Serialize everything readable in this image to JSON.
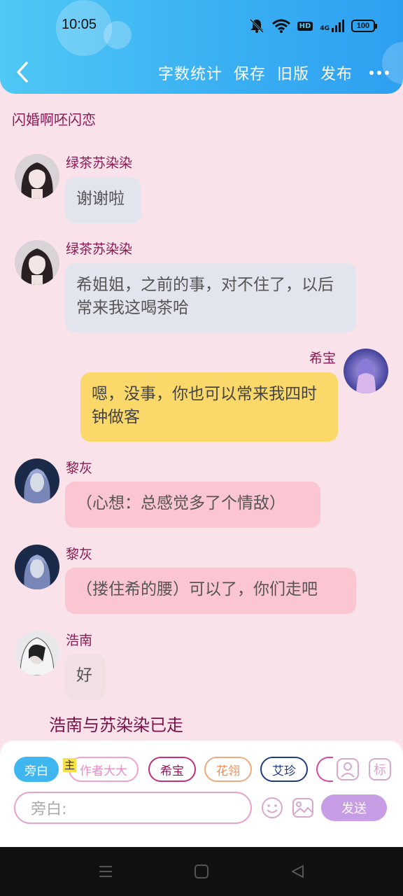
{
  "status_bar": {
    "time": "10:05",
    "hd_label": "HD",
    "network_label": "4G",
    "battery": "100"
  },
  "header": {
    "actions": [
      "字数统计",
      "保存",
      "旧版",
      "发布"
    ]
  },
  "page_title": "闪婚啊呸闪恋",
  "messages": [
    {
      "sender": "绿茶苏染染",
      "text": "谢谢啦",
      "side": "left",
      "style": "gray"
    },
    {
      "sender": "绿茶苏染染",
      "text": "希姐姐，之前的事，对不住了，以后常来我这喝茶哈",
      "side": "left",
      "style": "gray"
    },
    {
      "sender": "希宝",
      "text": "嗯，没事，你也可以常来我四时钟做客",
      "side": "right",
      "style": "yellow"
    },
    {
      "sender": "黎灰",
      "text": "（心想：总感觉多了个情敌）",
      "side": "left",
      "style": "pink"
    },
    {
      "sender": "黎灰",
      "text": "（搂住希的腰）可以了，你们走吧",
      "side": "left",
      "style": "pink"
    },
    {
      "sender": "浩南",
      "text": "好",
      "side": "left",
      "style": "gray"
    }
  ],
  "narration": "浩南与苏染染已走",
  "role_chips": [
    "旁白",
    "作者大大",
    "希宝",
    "花翎",
    "艾珍"
  ],
  "host_tag": "主",
  "side_icons": [
    "人",
    "标"
  ],
  "input": {
    "placeholder": "旁白:",
    "send_label": "发送"
  },
  "colors": {
    "header": "#3ab0f3",
    "background": "#f9e2ea",
    "sender_name": "#8a1a54",
    "bubble_gray": "#e2e5ee",
    "bubble_yellow": "#fbd86a",
    "bubble_pink": "#fbc5d1",
    "send_button": "#c79ee6"
  }
}
